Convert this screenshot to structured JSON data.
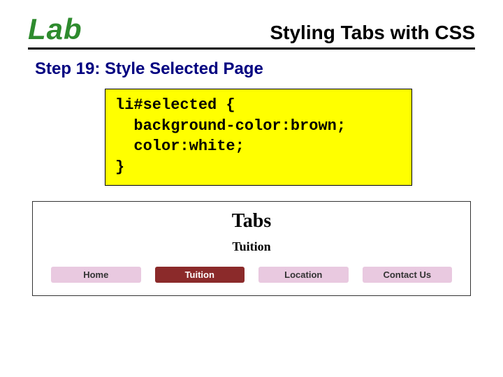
{
  "header": {
    "lab_label": "Lab",
    "title": "Styling Tabs with CSS"
  },
  "step": {
    "heading": "Step 19:  Style Selected Page"
  },
  "code": "li#selected {\n  background-color:brown;\n  color:white;\n}",
  "preview": {
    "heading": "Tabs",
    "subheading": "Tuition",
    "tabs": [
      {
        "label": "Home",
        "selected": false
      },
      {
        "label": "Tuition",
        "selected": true
      },
      {
        "label": "Location",
        "selected": false
      },
      {
        "label": "Contact Us",
        "selected": false
      }
    ]
  }
}
